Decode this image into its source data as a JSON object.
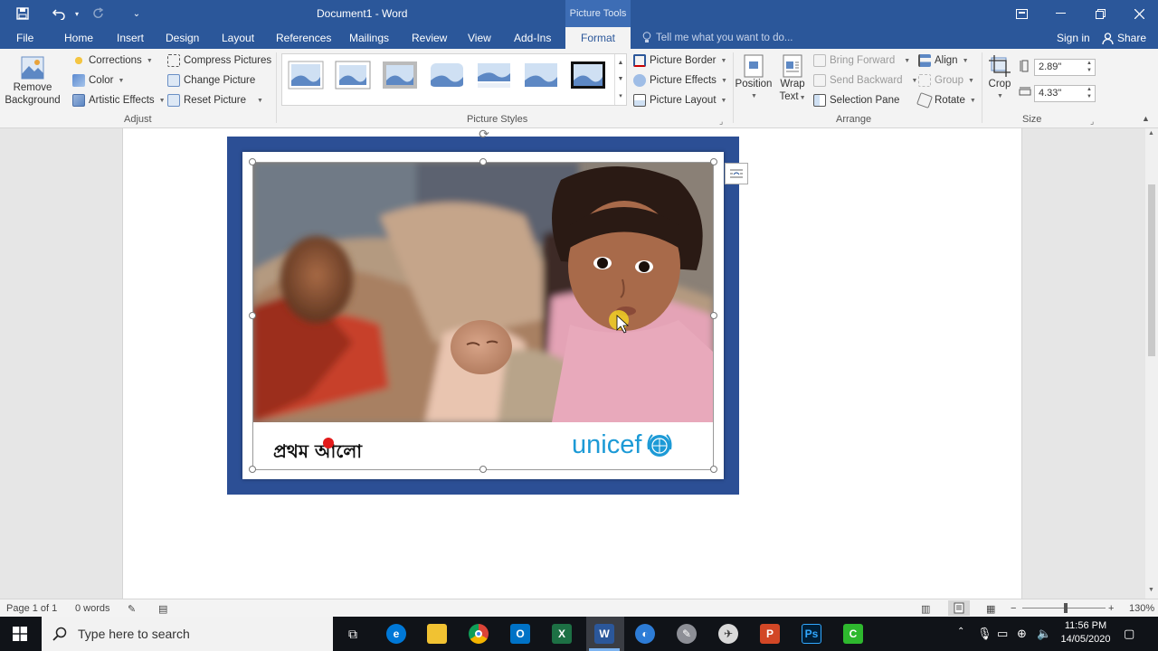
{
  "titlebar": {
    "doc_title": "Document1 - Word",
    "context_tab": "Picture Tools"
  },
  "tabs": [
    "File",
    "Home",
    "Insert",
    "Design",
    "Layout",
    "References",
    "Mailings",
    "Review",
    "View",
    "Add-Ins",
    "Format"
  ],
  "active_tab": "Format",
  "tell_me_placeholder": "Tell me what you want to do...",
  "account": {
    "signin": "Sign in",
    "share": "Share"
  },
  "ribbon": {
    "adjust": {
      "remove_bg_line1": "Remove",
      "remove_bg_line2": "Background",
      "corrections": "Corrections",
      "color": "Color",
      "artistic": "Artistic Effects",
      "compress": "Compress Pictures",
      "change": "Change Picture",
      "reset": "Reset Picture",
      "label": "Adjust"
    },
    "picture_styles": {
      "border": "Picture Border",
      "effects": "Picture Effects",
      "layout": "Picture Layout",
      "label": "Picture Styles"
    },
    "arrange": {
      "position": "Position",
      "wrap_line1": "Wrap",
      "wrap_line2": "Text",
      "bring_forward": "Bring Forward",
      "send_backward": "Send Backward",
      "selection_pane": "Selection Pane",
      "align": "Align",
      "group": "Group",
      "rotate": "Rotate",
      "label": "Arrange"
    },
    "size": {
      "crop": "Crop",
      "height": "2.89\"",
      "width": "4.33\"",
      "label": "Size"
    }
  },
  "picture": {
    "logo_left": "প্রথম আলো",
    "logo_right": "unicef"
  },
  "status": {
    "page": "Page 1 of 1",
    "words": "0 words",
    "zoom": "130%"
  },
  "taskbar": {
    "search_placeholder": "Type here to search",
    "time": "11:56 PM",
    "date": "14/05/2020"
  },
  "colors": {
    "word_blue": "#2b579a",
    "frame_blue": "#2c4f95",
    "unicef_blue": "#1c9ad6"
  }
}
